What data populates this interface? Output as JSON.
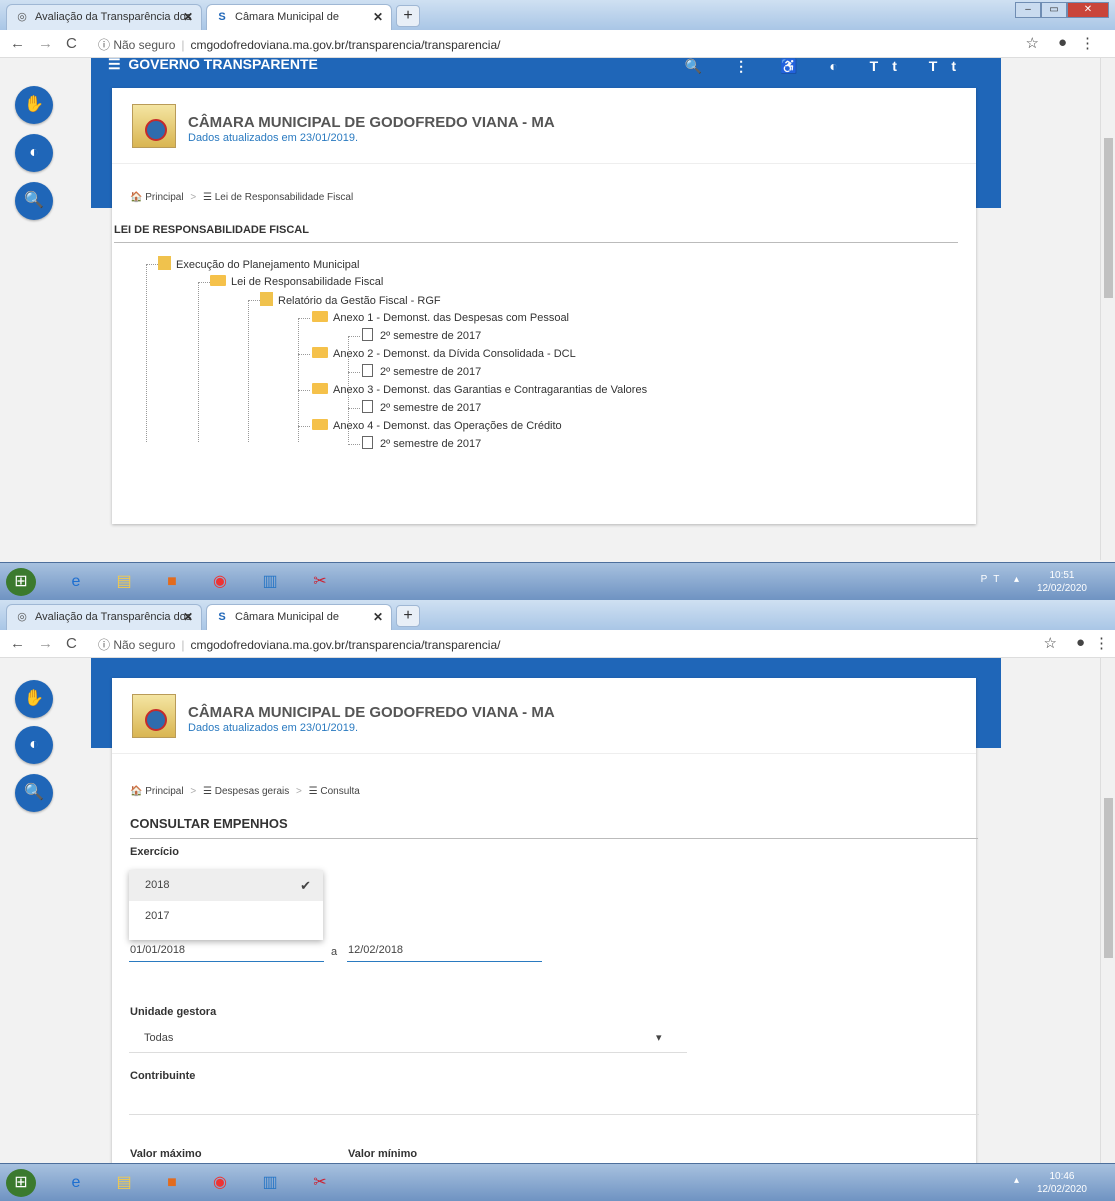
{
  "browser": {
    "tab1_title": "Avaliação da Transparência dos ",
    "tab2_title": "Câmara Municipal de Godofredo",
    "tab_close": "✕",
    "new_tab": "+",
    "not_secure": "ⓘ Não seguro",
    "url": "cmgodofredoviana.ma.gov.br/transparencia/transparencia/",
    "back": "←",
    "forward": "→",
    "reload": "C",
    "star": "☆",
    "account": "●",
    "menu": "⋮"
  },
  "site": {
    "gov_title": "GOVERNO TRANSPARENTE",
    "org_name": "CÂMARA MUNICIPAL DE GODOFREDO VIANA - MA",
    "updated": "Dados atualizados em 23/01/2019.",
    "toolbar": "🔍 ⋮ ♿ ◐ Tt Tt"
  },
  "shot1": {
    "breadcrumb_home": "Principal",
    "breadcrumb_sep": ">",
    "breadcrumb_current": "Lei de Responsabilidade Fiscal",
    "section_title": "LEI DE RESPONSABILIDADE FISCAL",
    "tree": {
      "root": "Execução do Planejamento Municipal",
      "level1": "Lei de Responsabilidade Fiscal",
      "level2": "Relatório da Gestão Fiscal - RGF",
      "annexes": [
        {
          "title": "Anexo 1 - Demonst. das Despesas com Pessoal",
          "child": "2º semestre de 2017"
        },
        {
          "title": "Anexo 2 - Demonst. da Dívida Consolidada - DCL",
          "child": "2º semestre de 2017"
        },
        {
          "title": "Anexo 3 - Demonst. das Garantias e Contragarantias de Valores",
          "child": "2º semestre de 2017"
        },
        {
          "title": "Anexo 4 - Demonst. das Operações de Crédito",
          "child": "2º semestre de 2017"
        }
      ]
    },
    "clock_time": "10:51",
    "clock_date": "12/02/2020",
    "tray": "PT ▴"
  },
  "shot2": {
    "breadcrumb_home": "Principal",
    "breadcrumb_mid": "Despesas gerais",
    "breadcrumb_current": "Consulta",
    "section_title": "CONSULTAR EMPENHOS",
    "exercicio_label": "Exercício",
    "options": [
      "2018",
      "2017"
    ],
    "selected_check": "✔",
    "date_from": "01/01/2018",
    "date_sep": "a",
    "date_to": "12/02/2018",
    "unidade_label": "Unidade gestora",
    "unidade_value": "Todas",
    "unidade_caret": "▾",
    "contribuinte_label": "Contribuinte",
    "valor_max_label": "Valor máximo",
    "valor_min_label": "Valor mínimo",
    "clock_time": "10:46",
    "clock_date": "12/02/2020",
    "tray": "▴"
  },
  "sidebar_icons": [
    "✋",
    "◐",
    "🔍"
  ]
}
